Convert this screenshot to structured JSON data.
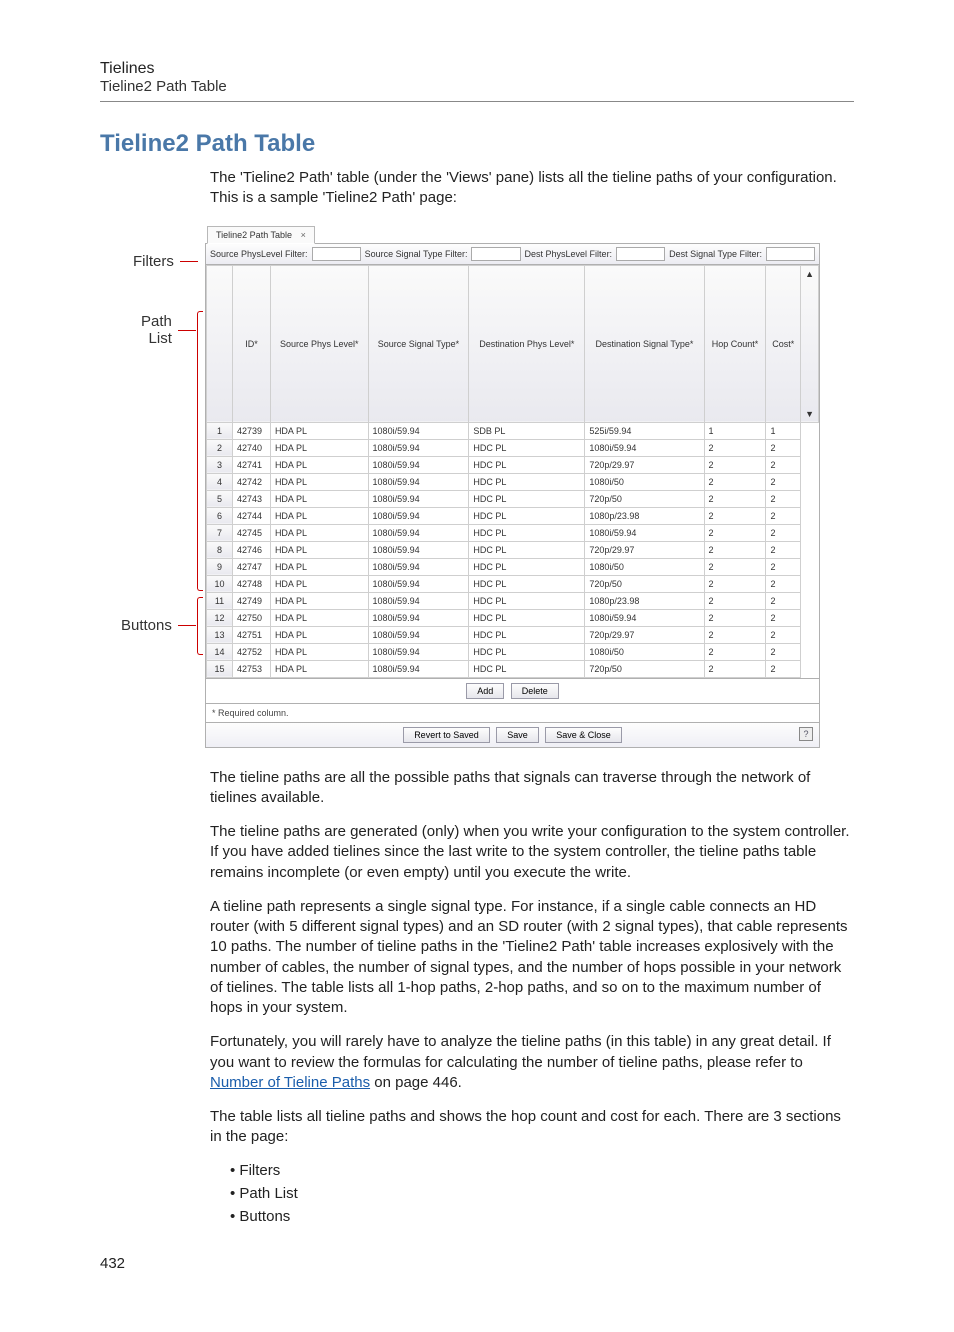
{
  "header": {
    "title": "Tielines",
    "subtitle": "Tieline2 Path Table"
  },
  "section_title": "Tieline2 Path Table",
  "intro1": "The 'Tieline2 Path' table (under the 'Views' pane) lists all the tieline paths of your configuration. This is a sample 'Tieline2 Path' page:",
  "labels": {
    "filters": "Filters",
    "pathlist": "Path\nList",
    "buttons": "Buttons"
  },
  "tab_title": "Tieline2 Path Table",
  "filters": {
    "f1": "Source PhysLevel Filter:",
    "f2": "Source Signal Type Filter:",
    "f3": "Dest PhysLevel Filter:",
    "f4": "Dest Signal Type Filter:"
  },
  "columns": [
    "ID*",
    "Source Phys Level*",
    "Source Signal Type*",
    "Destination Phys Level*",
    "Destination Signal Type*",
    "Hop Count*",
    "Cost*"
  ],
  "rows": [
    {
      "n": 1,
      "id": "42739",
      "spl": "HDA PL",
      "sst": "1080i/59.94",
      "dpl": "SDB PL",
      "dst": "525i/59.94",
      "hc": "1",
      "c": "1"
    },
    {
      "n": 2,
      "id": "42740",
      "spl": "HDA PL",
      "sst": "1080i/59.94",
      "dpl": "HDC PL",
      "dst": "1080i/59.94",
      "hc": "2",
      "c": "2"
    },
    {
      "n": 3,
      "id": "42741",
      "spl": "HDA PL",
      "sst": "1080i/59.94",
      "dpl": "HDC PL",
      "dst": "720p/29.97",
      "hc": "2",
      "c": "2"
    },
    {
      "n": 4,
      "id": "42742",
      "spl": "HDA PL",
      "sst": "1080i/59.94",
      "dpl": "HDC PL",
      "dst": "1080i/50",
      "hc": "2",
      "c": "2"
    },
    {
      "n": 5,
      "id": "42743",
      "spl": "HDA PL",
      "sst": "1080i/59.94",
      "dpl": "HDC PL",
      "dst": "720p/50",
      "hc": "2",
      "c": "2"
    },
    {
      "n": 6,
      "id": "42744",
      "spl": "HDA PL",
      "sst": "1080i/59.94",
      "dpl": "HDC PL",
      "dst": "1080p/23.98",
      "hc": "2",
      "c": "2"
    },
    {
      "n": 7,
      "id": "42745",
      "spl": "HDA PL",
      "sst": "1080i/59.94",
      "dpl": "HDC PL",
      "dst": "1080i/59.94",
      "hc": "2",
      "c": "2"
    },
    {
      "n": 8,
      "id": "42746",
      "spl": "HDA PL",
      "sst": "1080i/59.94",
      "dpl": "HDC PL",
      "dst": "720p/29.97",
      "hc": "2",
      "c": "2"
    },
    {
      "n": 9,
      "id": "42747",
      "spl": "HDA PL",
      "sst": "1080i/59.94",
      "dpl": "HDC PL",
      "dst": "1080i/50",
      "hc": "2",
      "c": "2"
    },
    {
      "n": 10,
      "id": "42748",
      "spl": "HDA PL",
      "sst": "1080i/59.94",
      "dpl": "HDC PL",
      "dst": "720p/50",
      "hc": "2",
      "c": "2"
    },
    {
      "n": 11,
      "id": "42749",
      "spl": "HDA PL",
      "sst": "1080i/59.94",
      "dpl": "HDC PL",
      "dst": "1080p/23.98",
      "hc": "2",
      "c": "2"
    },
    {
      "n": 12,
      "id": "42750",
      "spl": "HDA PL",
      "sst": "1080i/59.94",
      "dpl": "HDC PL",
      "dst": "1080i/59.94",
      "hc": "2",
      "c": "2"
    },
    {
      "n": 13,
      "id": "42751",
      "spl": "HDA PL",
      "sst": "1080i/59.94",
      "dpl": "HDC PL",
      "dst": "720p/29.97",
      "hc": "2",
      "c": "2"
    },
    {
      "n": 14,
      "id": "42752",
      "spl": "HDA PL",
      "sst": "1080i/59.94",
      "dpl": "HDC PL",
      "dst": "1080i/50",
      "hc": "2",
      "c": "2"
    },
    {
      "n": 15,
      "id": "42753",
      "spl": "HDA PL",
      "sst": "1080i/59.94",
      "dpl": "HDC PL",
      "dst": "720p/50",
      "hc": "2",
      "c": "2"
    }
  ],
  "ui_buttons": {
    "add": "Add",
    "delete": "Delete",
    "revert": "Revert to Saved",
    "save": "Save",
    "save_close": "Save & Close"
  },
  "required_note": "* Required column.",
  "para2": "The tieline paths are all the possible paths that signals can traverse through the network of tielines available.",
  "para3": "The tieline paths are generated (only) when you write your configuration to the system controller. If you have added tielines since the last write to the system controller, the tieline paths table remains incomplete (or even empty) until you execute the write.",
  "para4": "A tieline path represents a single signal type. For instance, if a single cable connects an HD router (with 5 different signal types) and an SD router (with 2 signal types), that cable represents 10 paths. The number of tieline paths in the 'Tieline2 Path' table increases explosively with the number of cables, the number of signal types, and the number of hops possible in your network of tielines. The table lists all 1-hop paths, 2-hop paths, and so on to the maximum number of hops in your system.",
  "para5a": "Fortunately, you will rarely have to analyze the tieline paths (in this table) in any great detail. If you want to review the formulas for calculating the number of tieline paths, please refer to ",
  "para5_link": "Number of Tieline Paths",
  "para5b": " on page 446.",
  "para6": "The table lists all tieline paths and shows the hop count and cost for each. There are 3 sections in the page:",
  "bullets": [
    "Filters",
    "Path List",
    "Buttons"
  ],
  "page_number": "432"
}
